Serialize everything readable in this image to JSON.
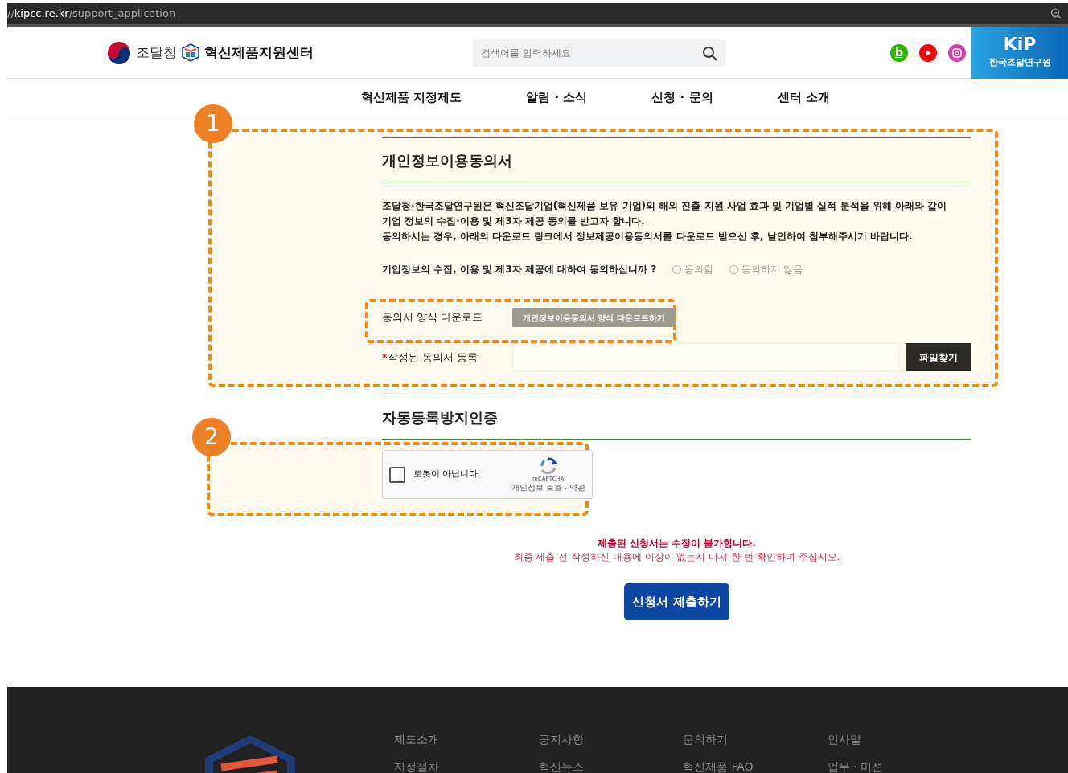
{
  "browser": {
    "url_prefix": "//",
    "url_host": "kipcc.re.kr",
    "url_path": "/support_application"
  },
  "header": {
    "agency_name": "조달청",
    "center_name": "혁신제품지원센터",
    "search": {
      "placeholder": "검색어를 입력하세요"
    },
    "social": [
      {
        "kind": "blog",
        "label": "b",
        "color": "#2db400"
      },
      {
        "kind": "video",
        "color": "#ff0000"
      },
      {
        "kind": "instagram",
        "color": "#d93fa8"
      }
    ],
    "institute_logo": {
      "mark": "KiP",
      "name": "한국조달연구원"
    }
  },
  "nav": [
    {
      "label": "혁신제품 지정제도"
    },
    {
      "label": "알림 · 소식"
    },
    {
      "label": "신청 · 문의"
    },
    {
      "label": "센터 소개"
    }
  ],
  "consent": {
    "annotation_number": "1",
    "title": "개인정보이용동의서",
    "paragraphs": [
      "조달청·한국조달연구원은 혁신조달기업(혁신제품 보유 기업)의 해외 진출 지원 사업 효과 및 기업별 실적 분석을 위해 아래와 같이 기업 정보의 수집·이용 및 제3자 제공 동의를 받고자 합니다.",
      "동의하시는 경우, 아래의 다운로드 링크에서 정보제공이용동의서를 다운로드 받으신 후, 날인하여 첨부해주시기 바랍니다."
    ],
    "question": "기업정보의 수집, 이용 및 제3자 제공에 대하여 동의하십니까 ?",
    "options": [
      {
        "label": "동의함",
        "selected": false
      },
      {
        "label": "동의하지 않음",
        "selected": false
      }
    ],
    "download": {
      "annotated": true,
      "label": "동의서 양식 다운로드",
      "button": "개인정보이용동의서 양식 다운로드하기"
    },
    "upload": {
      "required_mark": "*",
      "label": "작성된 동의서 등록",
      "button": "파일찾기"
    }
  },
  "captcha": {
    "annotation_number": "2",
    "title": "자동등록방지인증",
    "checkbox_label": "로봇이 아닙니다.",
    "checked": false,
    "brand": "reCAPTCHA",
    "links": "개인정보 보호 - 약관"
  },
  "notice": [
    "제출된 신청서는 수정이 불가합니다.",
    "최종 제출 전 작성하신 내용에 이상이 없는지 다시 한 번 확인하여 주십시오."
  ],
  "submit_button": "신청서 제출하기",
  "footer": {
    "columns": [
      [
        "제도소개",
        "지정절차"
      ],
      [
        "공지사항",
        "혁신뉴스"
      ],
      [
        "문의하기",
        "혁신제품 FAQ"
      ],
      [
        "인사말",
        "업무 · 미션"
      ]
    ]
  }
}
